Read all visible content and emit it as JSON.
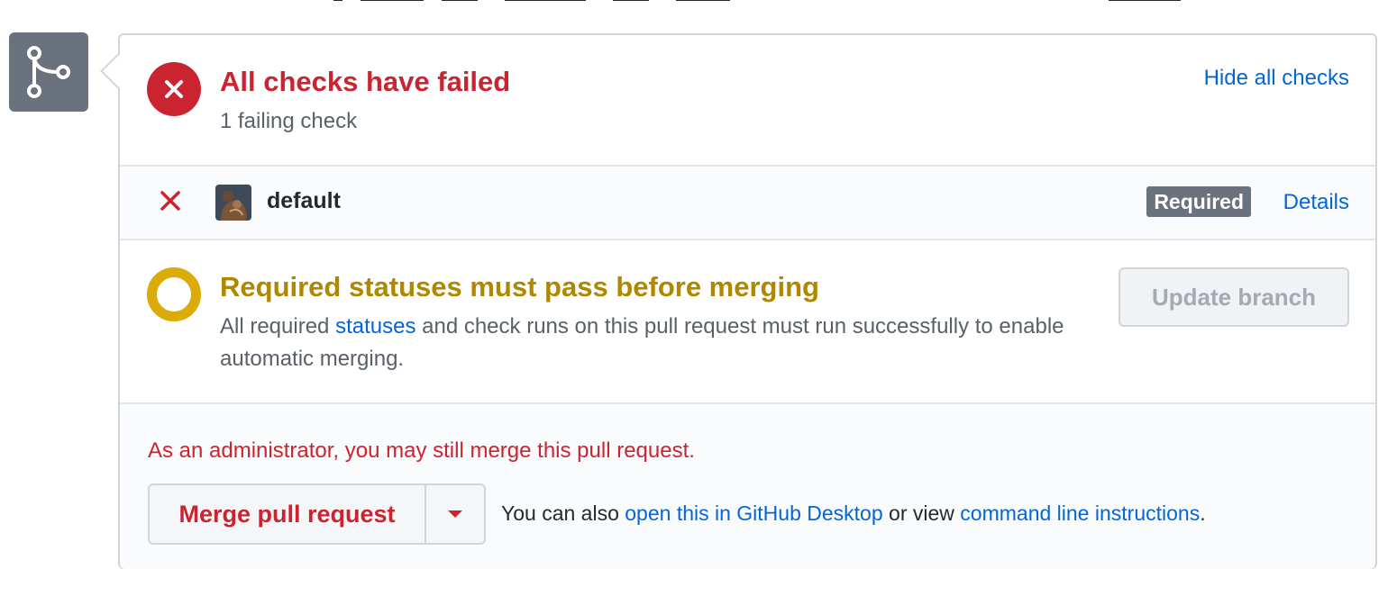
{
  "status": {
    "title": "All checks have failed",
    "subtitle": "1 failing check",
    "toggle_label": "Hide all checks",
    "icon": "x-circle-icon",
    "color": "#cb2431"
  },
  "checks": [
    {
      "name": "default",
      "state_icon": "x-icon",
      "badge": "Required",
      "details_label": "Details"
    }
  ],
  "required": {
    "title": "Required statuses must pass before merging",
    "desc_before": "All required ",
    "desc_link": "statuses",
    "desc_after": " and check runs on this pull request must run successfully to enable automatic merging.",
    "update_button": "Update branch",
    "icon": "pending-circle-icon",
    "color": "#b08800"
  },
  "merge": {
    "admin_note": "As an administrator, you may still merge this pull request.",
    "merge_button": "Merge pull request",
    "caret_icon": "triangle-down-icon",
    "also_prefix": "You can also ",
    "desktop_link": "open this in GitHub Desktop",
    "or_view": " or view ",
    "cli_link": "command line instructions",
    "suffix": "."
  },
  "sidebar_icon": "git-merge-icon",
  "colors": {
    "link": "#0366d6",
    "danger": "#cb2431",
    "badge_gray": "#6a737d",
    "border": "#d1d5da"
  }
}
